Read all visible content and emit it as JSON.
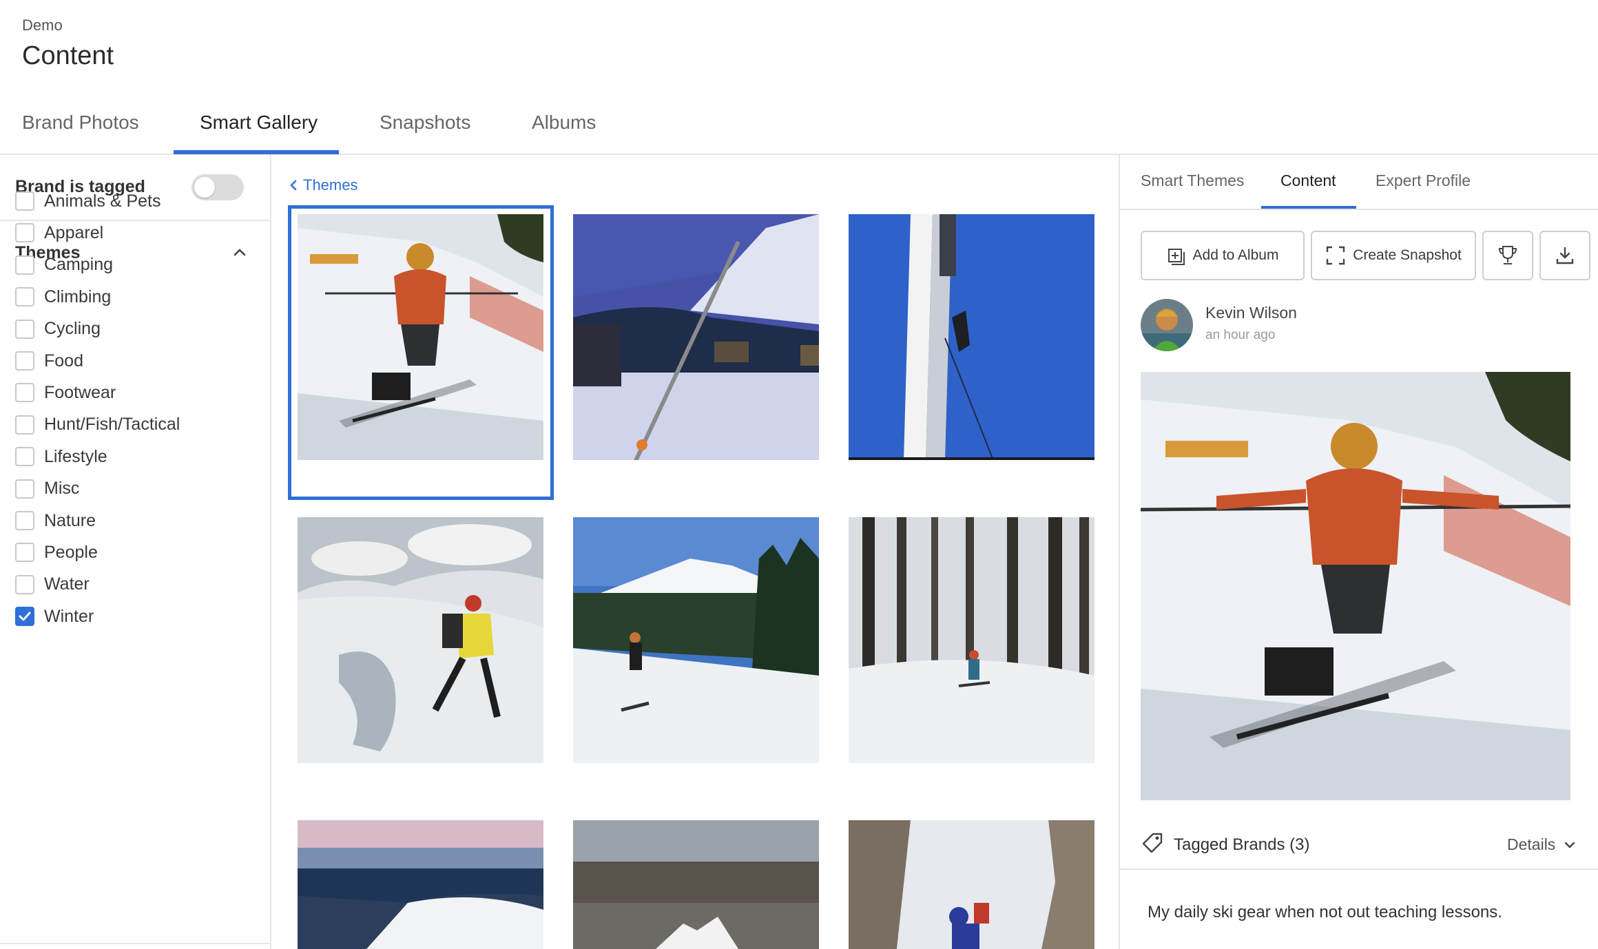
{
  "header": {
    "breadcrumb": "Demo",
    "title": "Content",
    "tabs": [
      {
        "label": "Brand Photos",
        "active": false
      },
      {
        "label": "Smart Gallery",
        "active": true
      },
      {
        "label": "Snapshots",
        "active": false
      },
      {
        "label": "Albums",
        "active": false
      }
    ]
  },
  "sidebar": {
    "brand_tagged_label": "Brand is tagged",
    "brand_tagged_on": false,
    "themes_heading": "Themes",
    "themes": [
      {
        "label": "Animals & Pets",
        "checked": false
      },
      {
        "label": "Apparel",
        "checked": false
      },
      {
        "label": "Camping",
        "checked": false
      },
      {
        "label": "Climbing",
        "checked": false
      },
      {
        "label": "Cycling",
        "checked": false
      },
      {
        "label": "Food",
        "checked": false
      },
      {
        "label": "Footwear",
        "checked": false
      },
      {
        "label": "Hunt/Fish/Tactical",
        "checked": false
      },
      {
        "label": "Lifestyle",
        "checked": false
      },
      {
        "label": "Misc",
        "checked": false
      },
      {
        "label": "Nature",
        "checked": false
      },
      {
        "label": "People",
        "checked": false
      },
      {
        "label": "Water",
        "checked": false
      },
      {
        "label": "Winter",
        "checked": true
      }
    ]
  },
  "gallery": {
    "back_label": "Themes",
    "selected_index": 0,
    "photos": [
      {
        "subject": "sit-skier on snowy slope"
      },
      {
        "subject": "chairlift over snowy village at dusk"
      },
      {
        "subject": "climber on tall white pole against blue sky"
      },
      {
        "subject": "mountaineer crossing crevasse"
      },
      {
        "subject": "snowboarder with snowy volcano"
      },
      {
        "subject": "snowboarder in snowy forest"
      },
      {
        "subject": "snowy ridge above clouds"
      },
      {
        "subject": "snowy summit over plains"
      },
      {
        "subject": "climber on rocky snow couloir"
      }
    ]
  },
  "detail": {
    "tabs": [
      {
        "label": "Smart Themes",
        "active": false
      },
      {
        "label": "Content",
        "active": true
      },
      {
        "label": "Expert Profile",
        "active": false
      }
    ],
    "actions": {
      "add_to_album": "Add to Album",
      "create_snapshot": "Create Snapshot"
    },
    "author": "Kevin Wilson",
    "posted": "an hour ago",
    "tagged_brands": "Tagged Brands (3)",
    "details_label": "Details",
    "caption": "My daily ski gear when not out teaching lessons."
  },
  "colors": {
    "accent": "#2f6fd6",
    "divider": "#e3e3e3"
  }
}
